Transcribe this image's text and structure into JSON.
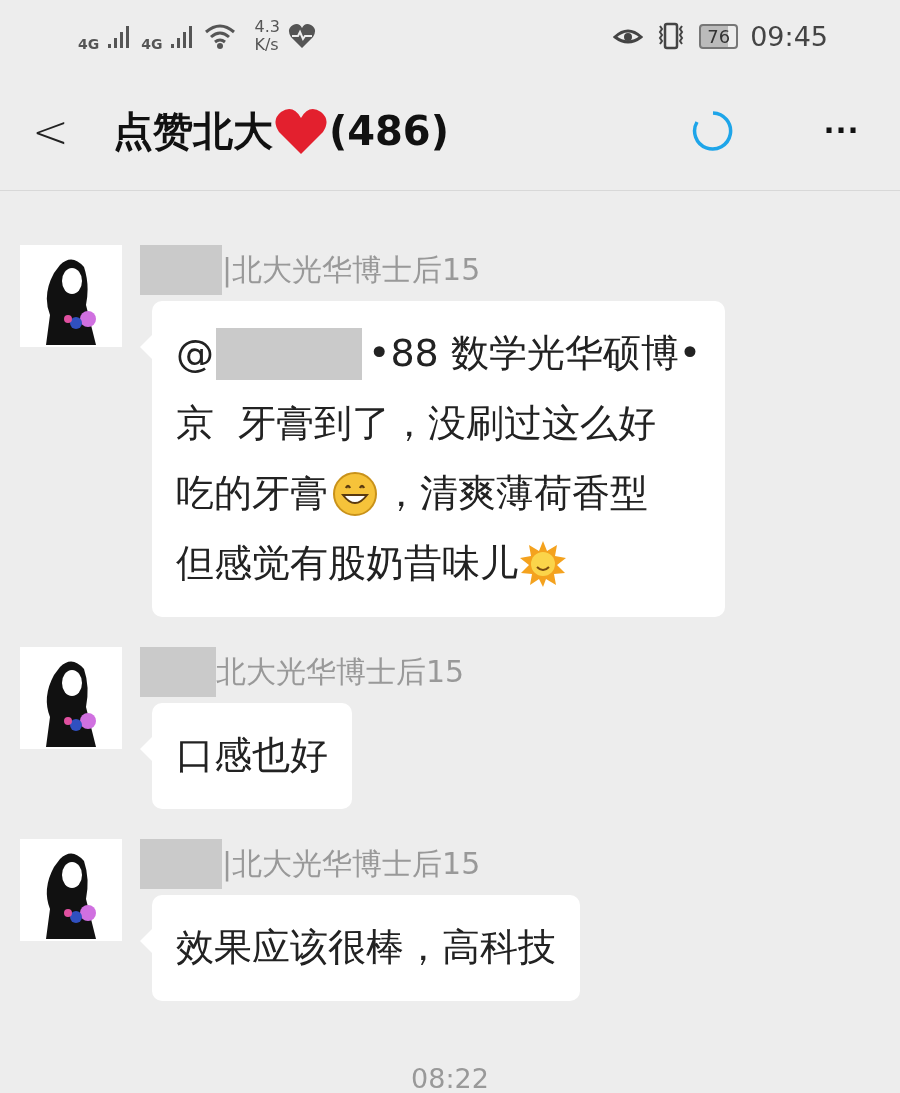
{
  "status_bar": {
    "network_1": "4G",
    "network_2": "4G",
    "speed_value": "4.3",
    "speed_unit": "K/s",
    "battery": "76",
    "time": "09:45"
  },
  "header": {
    "back": "<",
    "title": [
      {
        "kind": "text",
        "text": "点赞北大"
      },
      {
        "kind": "heart"
      },
      {
        "kind": "text",
        "text": "(486)"
      }
    ],
    "more": "···"
  },
  "messages": [
    {
      "sender": "|北大光华博士后15",
      "lines": [
        [
          {
            "kind": "text",
            "text": "@"
          },
          {
            "kind": "redaction"
          },
          {
            "kind": "text",
            "text": "•88 数学光华硕博•"
          }
        ],
        [
          {
            "kind": "text",
            "text": "京  牙膏到了，没刷过这么好"
          }
        ],
        [
          {
            "kind": "text",
            "text": "吃的牙膏"
          },
          {
            "kind": "smiley"
          },
          {
            "kind": "text",
            "text": "，清爽薄荷香型"
          }
        ],
        [
          {
            "kind": "text",
            "text": "但感觉有股奶昔味儿"
          },
          {
            "kind": "sun"
          }
        ]
      ]
    },
    {
      "sender": "北大光华博士后15",
      "lines": [
        [
          {
            "kind": "text",
            "text": "口感也好"
          }
        ]
      ]
    },
    {
      "sender": "|北大光华博士后15",
      "lines": [
        [
          {
            "kind": "text",
            "text": "效果应该很棒，高科技"
          }
        ]
      ]
    }
  ],
  "timestamp": "08:22"
}
